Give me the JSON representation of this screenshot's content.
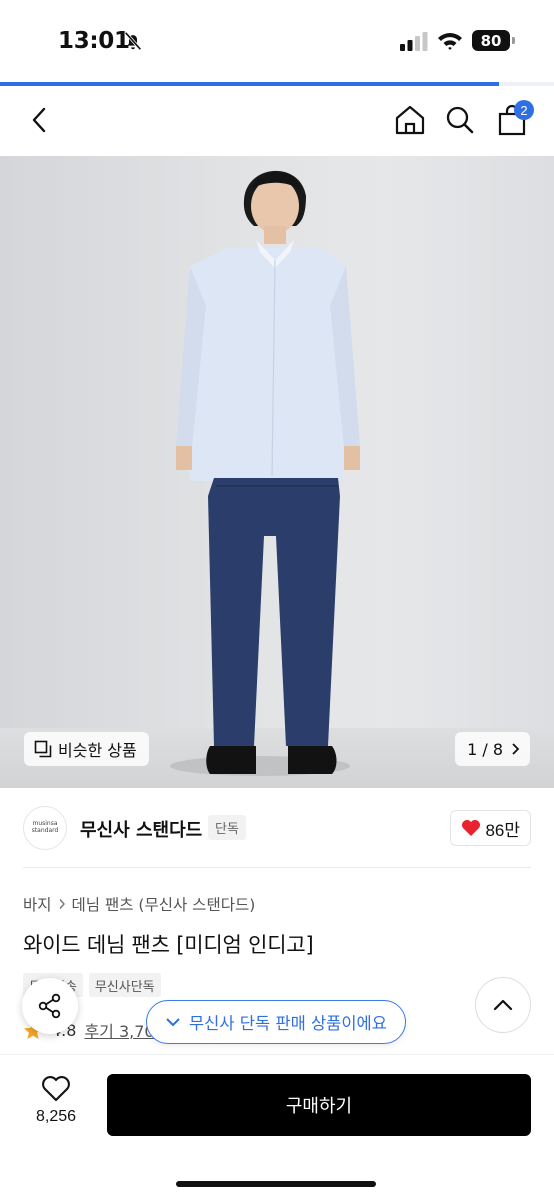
{
  "status_bar": {
    "time": "13:01",
    "battery": "80"
  },
  "page_progress": 0.9,
  "nav": {
    "cart_count": "2"
  },
  "hero": {
    "similar_label": "비슷한 상품",
    "image_counter": "1 / 8"
  },
  "brand": {
    "logo_line1": "musinsa",
    "logo_line2": "standard",
    "name": "무신사 스탠다드",
    "tag": "단독",
    "like_count": "86만"
  },
  "product": {
    "breadcrumb": [
      "바지",
      "데님 팬츠 (무신사 스탠다드)"
    ],
    "title": "와이드 데님 팬츠 [미디엄 인디고]",
    "tags": [
      "무료배송",
      "무신사단독"
    ],
    "rating": "4.8",
    "reviews": "후기 3,70"
  },
  "toast": {
    "exclusive_text": "무신사 단독 판매 상품이에요"
  },
  "bottom_bar": {
    "wish_count": "8,256",
    "buy_label": "구매하기"
  },
  "colors": {
    "accent": "#2f6fe4",
    "heart": "#e8222e",
    "star": "#f5a623",
    "buy_bg": "#000000"
  }
}
